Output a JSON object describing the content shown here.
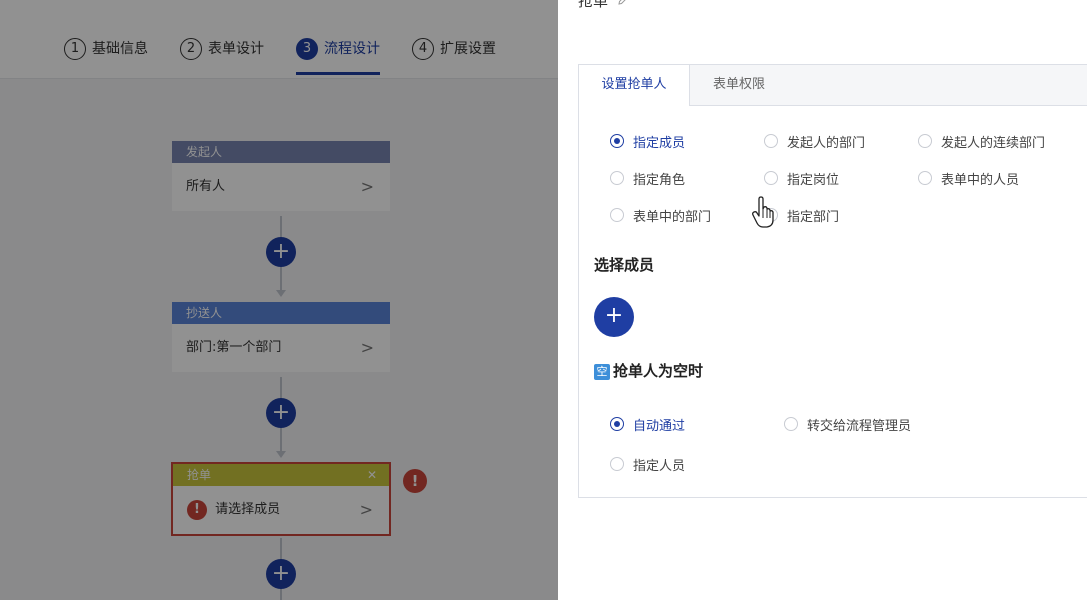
{
  "steps": [
    {
      "num": "1",
      "label": "基础信息"
    },
    {
      "num": "2",
      "label": "表单设计"
    },
    {
      "num": "3",
      "label": "流程设计"
    },
    {
      "num": "4",
      "label": "扩展设置"
    }
  ],
  "flow": {
    "initiator": {
      "header": "发起人",
      "body": "所有人"
    },
    "cc": {
      "header": "抄送人",
      "body": "部门:第一个部门"
    },
    "grab": {
      "header": "抢单",
      "body": "请选择成员"
    }
  },
  "colors": {
    "accent": "#1f3ea3",
    "initiator_head": "#7884b0",
    "cc_head": "#5a84d8",
    "grab_head": "#c8c63c",
    "error": "#c9463a"
  },
  "panel": {
    "title": "抢单",
    "tabs": [
      "设置抢单人",
      "表单权限"
    ],
    "options": [
      {
        "label": "指定成员",
        "checked": true
      },
      {
        "label": "发起人的部门",
        "checked": false
      },
      {
        "label": "发起人的连续部门",
        "checked": false
      },
      {
        "label": "指定角色",
        "checked": false
      },
      {
        "label": "指定岗位",
        "checked": false
      },
      {
        "label": "表单中的人员",
        "checked": false
      },
      {
        "label": "表单中的部门",
        "checked": false
      },
      {
        "label": "指定部门",
        "checked": false
      }
    ],
    "select_members_title": "选择成员",
    "empty_badge": "空",
    "empty_title": "抢单人为空时",
    "empty_options": [
      {
        "label": "自动通过",
        "checked": true
      },
      {
        "label": "转交给流程管理员",
        "checked": false
      },
      {
        "label": "指定人员",
        "checked": false
      }
    ]
  },
  "icons": {
    "plus": "+",
    "chevron": ">",
    "close": "✕",
    "warning": "!",
    "edit": "pencil-icon"
  }
}
